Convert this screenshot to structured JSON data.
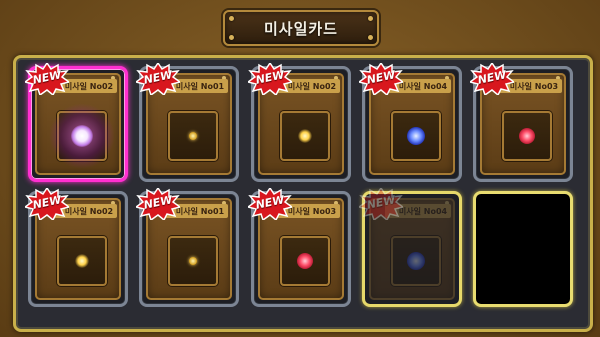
{
  "title": "미사일카드",
  "cards": [
    {
      "name": "미사일 No02",
      "badge": "NEW",
      "gem": "white",
      "state": "selected"
    },
    {
      "name": "미사일 No01",
      "badge": "NEW",
      "gem": "gold-small",
      "state": "normal"
    },
    {
      "name": "미사일 No02",
      "badge": "NEW",
      "gem": "spark",
      "state": "normal"
    },
    {
      "name": "미사일 No04",
      "badge": "NEW",
      "gem": "blue",
      "state": "normal"
    },
    {
      "name": "미사일 No03",
      "badge": "NEW",
      "gem": "red",
      "state": "normal"
    },
    {
      "name": "미사일 No02",
      "badge": "NEW",
      "gem": "spark",
      "state": "normal"
    },
    {
      "name": "미사일 No01",
      "badge": "NEW",
      "gem": "gold-small",
      "state": "normal"
    },
    {
      "name": "미사일 No03",
      "badge": "NEW",
      "gem": "red",
      "state": "normal"
    },
    {
      "name": "미사일 No04",
      "badge": "NEW",
      "gem": "blue",
      "state": "dimmed"
    }
  ],
  "colors": {
    "frame": "#6d4c1c",
    "board": "#2b2c33",
    "board_border": "#c9b04a",
    "selected_border": "#ff2fd0",
    "badge_red": "#d8171e"
  }
}
